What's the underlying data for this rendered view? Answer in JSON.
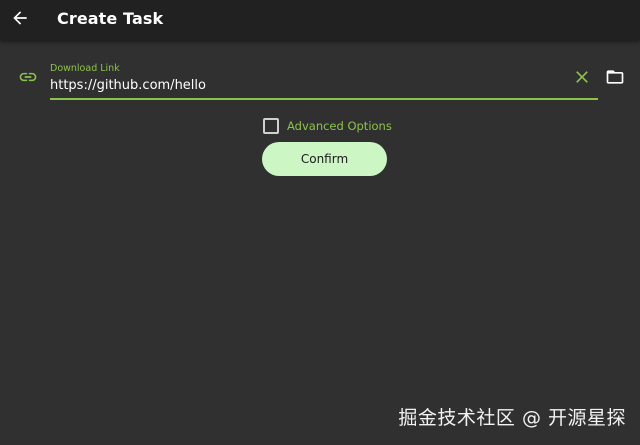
{
  "appbar": {
    "title": "Create Task",
    "back_icon": "arrow-left-icon"
  },
  "link_field": {
    "label": "Download Link",
    "value": "https://github.com/hello",
    "leading_icon": "link-icon",
    "clear_icon": "close-icon",
    "browse_icon": "folder-icon"
  },
  "advanced_options": {
    "label": "Advanced Options",
    "checked": false
  },
  "confirm": {
    "label": "Confirm"
  },
  "watermark": {
    "text": "掘金技术社区 @ 开源星探"
  },
  "colors": {
    "background": "#303030",
    "appbar": "#212121",
    "accent": "#8bc34a",
    "button": "#ccf7c4"
  }
}
